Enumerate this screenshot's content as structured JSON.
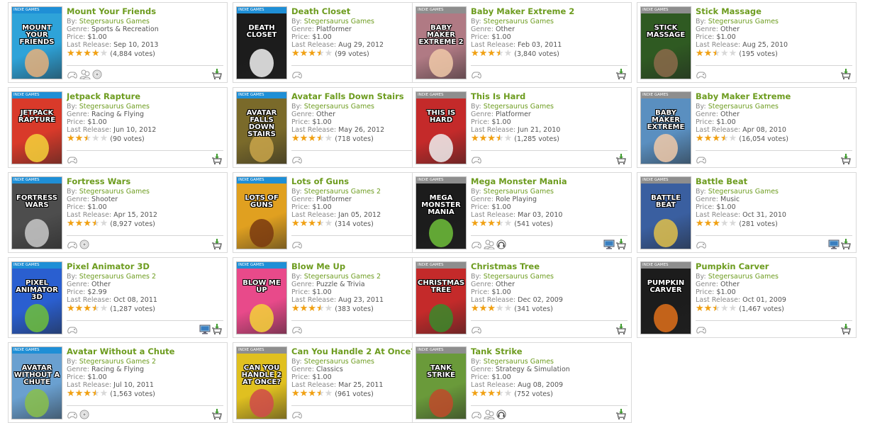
{
  "labels": {
    "badge": "INDIE GAMES",
    "by": "By:",
    "genre": "Genre:",
    "price": "Price:",
    "last_release": "Last Release:"
  },
  "colors": {
    "title_green": "#6d9c1f",
    "star_orange": "#f2a112",
    "badge_blue": "#1f8fd6",
    "badge_gray": "#8e8e8e"
  },
  "games": [
    {
      "title": "Mount Your Friends",
      "publisher": "Stegersaurus Games",
      "genre": "Sports & Recreation",
      "price": "$1.00",
      "release": "Sep 10, 2013",
      "rating": 4,
      "votes": "(4,884 votes)",
      "features": [
        "controller-icon",
        "multiplayer-icon",
        "disc-icon"
      ],
      "cart": true,
      "pc": false,
      "thumb_top": "MOUNT YOUR FRIENDS",
      "band": "#1f8fd6",
      "bg": "#2ea3d9",
      "accent": "#e8b07a"
    },
    {
      "title": "Death Closet",
      "publisher": "Stegersaurus Games",
      "genre": "Platformer",
      "price": "$1.00",
      "release": "Aug 29, 2012",
      "rating": 3.5,
      "votes": "(99 votes)",
      "features": [
        "controller-icon"
      ],
      "cart": false,
      "pc": false,
      "thumb_top": "DEATH CLOSET",
      "band": "#1f8fd6",
      "bg": "#1c1c1c",
      "accent": "#f2f2f2"
    },
    {
      "title": "Baby Maker Extreme 2",
      "publisher": "Stegersaurus Games",
      "genre": "Other",
      "price": "$1.00",
      "release": "Feb 03, 2011",
      "rating": 3.5,
      "votes": "(3,840 votes)",
      "features": [
        "controller-icon"
      ],
      "cart": true,
      "pc": false,
      "thumb_top": "BABY MAKER EXTREME 2",
      "band": "#8e8e8e",
      "bg": "#b07a84",
      "accent": "#f0c9a8"
    },
    {
      "title": "Stick Massage",
      "publisher": "Stegersaurus Games",
      "genre": "Other",
      "price": "$1.00",
      "release": "Aug 25, 2010",
      "rating": 2.5,
      "votes": "(195 votes)",
      "features": [
        "controller-icon"
      ],
      "cart": true,
      "pc": false,
      "thumb_top": "STICK MASSAGE",
      "band": "#8e8e8e",
      "bg": "#2f5a22",
      "accent": "#8b6a4a"
    },
    {
      "title": "Jetpack Rapture",
      "publisher": "Stegersaurus Games",
      "genre": "Racing & Flying",
      "price": "$1.00",
      "release": "Jun 10, 2012",
      "rating": 2.5,
      "votes": "(90 votes)",
      "features": [
        "controller-icon"
      ],
      "cart": true,
      "pc": false,
      "thumb_top": "JETPACK RAPTURE",
      "band": "#1f8fd6",
      "bg": "#d93a2a",
      "accent": "#f5d23a"
    },
    {
      "title": "Avatar Falls Down Stairs",
      "publisher": "Stegersaurus Games",
      "genre": "Other",
      "price": "$1.00",
      "release": "May 26, 2012",
      "rating": 3.5,
      "votes": "(718 votes)",
      "features": [
        "controller-icon"
      ],
      "cart": false,
      "pc": false,
      "thumb_top": "AVATAR FALLS DOWN STAIRS",
      "band": "#1f8fd6",
      "bg": "#7a6a2a",
      "accent": "#c9a44a"
    },
    {
      "title": "This Is Hard",
      "publisher": "Stegersaurus Games",
      "genre": "Platformer",
      "price": "$1.00",
      "release": "Jun 21, 2010",
      "rating": 3.5,
      "votes": "(1,285 votes)",
      "features": [
        "controller-icon"
      ],
      "cart": true,
      "pc": false,
      "thumb_top": "THIS IS HARD",
      "band": "#8e8e8e",
      "bg": "#c42a2a",
      "accent": "#eeeeee"
    },
    {
      "title": "Baby Maker Extreme",
      "publisher": "Stegersaurus Games",
      "genre": "Other",
      "price": "$1.00",
      "release": "Apr 08, 2010",
      "rating": 3.5,
      "votes": "(16,054 votes)",
      "features": [
        "controller-icon"
      ],
      "cart": true,
      "pc": false,
      "thumb_top": "BABY MAKER EXTREME",
      "band": "#8e8e8e",
      "bg": "#5a8fc0",
      "accent": "#f0c9a8"
    },
    {
      "title": "Fortress Wars",
      "publisher": "Stegersaurus Games",
      "genre": "Shooter",
      "price": "$1.00",
      "release": "Apr 15, 2012",
      "rating": 3.5,
      "votes": "(8,927 votes)",
      "features": [
        "controller-icon",
        "disc-icon"
      ],
      "cart": true,
      "pc": false,
      "thumb_top": "FORTRESS WARS",
      "band": "#1f8fd6",
      "bg": "#4d4d4d",
      "accent": "#c9c9c9"
    },
    {
      "title": "Lots of Guns",
      "publisher": "Stegersaurus Games 2",
      "genre": "Platformer",
      "price": "$1.00",
      "release": "Jan 05, 2012",
      "rating": 3.5,
      "votes": "(314 votes)",
      "features": [
        "controller-icon"
      ],
      "cart": false,
      "pc": false,
      "thumb_top": "LOTS OF GUNS",
      "band": "#1f8fd6",
      "bg": "#e0a020",
      "accent": "#7a3a10"
    },
    {
      "title": "Mega Monster Mania",
      "publisher": "Stegersaurus Games",
      "genre": "Role Playing",
      "price": "$1.00",
      "release": "Mar 03, 2010",
      "rating": 3.5,
      "votes": "(541 votes)",
      "features": [
        "controller-icon",
        "multiplayer-icon",
        "headset-icon"
      ],
      "cart": true,
      "pc": true,
      "thumb_top": "MEGA MONSTER MANIA",
      "band": "#8e8e8e",
      "bg": "#1c1c1c",
      "accent": "#6fbf3a"
    },
    {
      "title": "Battle Beat",
      "publisher": "Stegersaurus Games",
      "genre": "Music",
      "price": "$1.00",
      "release": "Oct 31, 2010",
      "rating": 3,
      "votes": "(281 votes)",
      "features": [
        "controller-icon"
      ],
      "cart": true,
      "pc": true,
      "thumb_top": "BATTLE BEAT",
      "band": "#8e8e8e",
      "bg": "#3a5fa0",
      "accent": "#e0c04a"
    },
    {
      "title": "Pixel Animator 3D",
      "publisher": "Stegersaurus Games 2",
      "genre": "Other",
      "price": "$2.99",
      "release": "Oct 08, 2011",
      "rating": 3.5,
      "votes": "(1,287 votes)",
      "features": [
        "controller-icon"
      ],
      "cart": true,
      "pc": true,
      "thumb_top": "PIXEL ANIMATOR 3D",
      "band": "#1f8fd6",
      "bg": "#2a5fd0",
      "accent": "#6fbf3a"
    },
    {
      "title": "Blow Me Up",
      "publisher": "Stegersaurus Games 2",
      "genre": "Puzzle & Trivia",
      "price": "$1.00",
      "release": "Aug 23, 2011",
      "rating": 3.5,
      "votes": "(383 votes)",
      "features": [
        "controller-icon"
      ],
      "cart": false,
      "pc": false,
      "thumb_top": "BLOW ME UP",
      "band": "#1f8fd6",
      "bg": "#e84a8a",
      "accent": "#f5d23a"
    },
    {
      "title": "Christmas Tree",
      "publisher": "Stegersaurus Games",
      "genre": "Other",
      "price": "$1.00",
      "release": "Dec 02, 2009",
      "rating": 3,
      "votes": "(341 votes)",
      "features": [
        "controller-icon"
      ],
      "cart": true,
      "pc": false,
      "thumb_top": "CHRISTMAS TREE",
      "band": "#8e8e8e",
      "bg": "#c42a2a",
      "accent": "#3a8a2a"
    },
    {
      "title": "Pumpkin Carver",
      "publisher": "Stegersaurus Games",
      "genre": "Other",
      "price": "$1.00",
      "release": "Oct 01, 2009",
      "rating": 2.5,
      "votes": "(1,467 votes)",
      "features": [
        "controller-icon"
      ],
      "cart": true,
      "pc": false,
      "thumb_top": "PUMPKIN CARVER",
      "band": "#8e8e8e",
      "bg": "#1c1c1c",
      "accent": "#e0701a"
    },
    {
      "title": "Avatar Without a Chute",
      "publisher": "Stegersaurus Games 2",
      "genre": "Racing & Flying",
      "price": "$1.00",
      "release": "Jul 10, 2011",
      "rating": 3.5,
      "votes": "(1,563 votes)",
      "features": [
        "controller-icon",
        "disc-icon"
      ],
      "cart": true,
      "pc": false,
      "thumb_top": "AVATAR WITHOUT A CHUTE",
      "band": "#1f8fd6",
      "bg": "#6aa0d0",
      "accent": "#8ac04a"
    },
    {
      "title": "Can You Handle 2 At Once?",
      "publisher": "Stegersaurus Games",
      "genre": "Classics",
      "price": "$1.00",
      "release": "Mar 25, 2011",
      "rating": 3.5,
      "votes": "(961 votes)",
      "features": [
        "controller-icon"
      ],
      "cart": false,
      "pc": false,
      "thumb_top": "CAN YOU HANDLE 2 AT ONCE?",
      "band": "#8e8e8e",
      "bg": "#e0c020",
      "accent": "#d04a4a"
    },
    {
      "title": "Tank Strike",
      "publisher": "Stegersaurus Games",
      "genre": "Strategy & Simulation",
      "price": "$1.00",
      "release": "Aug 08, 2009",
      "rating": 3.5,
      "votes": "(752 votes)",
      "features": [
        "controller-icon",
        "multiplayer-icon",
        "headset-icon"
      ],
      "cart": true,
      "pc": false,
      "thumb_top": "TANK STRIKE",
      "band": "#8e8e8e",
      "bg": "#6a9a3a",
      "accent": "#c04a2a"
    }
  ]
}
